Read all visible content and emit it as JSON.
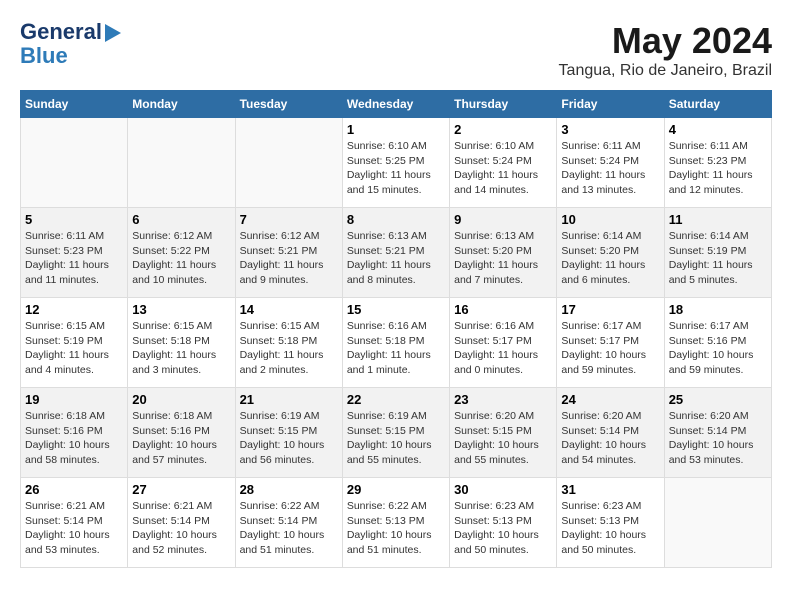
{
  "header": {
    "logo_line1": "General",
    "logo_line2": "Blue",
    "month_title": "May 2024",
    "location": "Tangua, Rio de Janeiro, Brazil"
  },
  "days_of_week": [
    "Sunday",
    "Monday",
    "Tuesday",
    "Wednesday",
    "Thursday",
    "Friday",
    "Saturday"
  ],
  "weeks": [
    [
      {
        "day": "",
        "info": ""
      },
      {
        "day": "",
        "info": ""
      },
      {
        "day": "",
        "info": ""
      },
      {
        "day": "1",
        "info": "Sunrise: 6:10 AM\nSunset: 5:25 PM\nDaylight: 11 hours\nand 15 minutes."
      },
      {
        "day": "2",
        "info": "Sunrise: 6:10 AM\nSunset: 5:24 PM\nDaylight: 11 hours\nand 14 minutes."
      },
      {
        "day": "3",
        "info": "Sunrise: 6:11 AM\nSunset: 5:24 PM\nDaylight: 11 hours\nand 13 minutes."
      },
      {
        "day": "4",
        "info": "Sunrise: 6:11 AM\nSunset: 5:23 PM\nDaylight: 11 hours\nand 12 minutes."
      }
    ],
    [
      {
        "day": "5",
        "info": "Sunrise: 6:11 AM\nSunset: 5:23 PM\nDaylight: 11 hours\nand 11 minutes."
      },
      {
        "day": "6",
        "info": "Sunrise: 6:12 AM\nSunset: 5:22 PM\nDaylight: 11 hours\nand 10 minutes."
      },
      {
        "day": "7",
        "info": "Sunrise: 6:12 AM\nSunset: 5:21 PM\nDaylight: 11 hours\nand 9 minutes."
      },
      {
        "day": "8",
        "info": "Sunrise: 6:13 AM\nSunset: 5:21 PM\nDaylight: 11 hours\nand 8 minutes."
      },
      {
        "day": "9",
        "info": "Sunrise: 6:13 AM\nSunset: 5:20 PM\nDaylight: 11 hours\nand 7 minutes."
      },
      {
        "day": "10",
        "info": "Sunrise: 6:14 AM\nSunset: 5:20 PM\nDaylight: 11 hours\nand 6 minutes."
      },
      {
        "day": "11",
        "info": "Sunrise: 6:14 AM\nSunset: 5:19 PM\nDaylight: 11 hours\nand 5 minutes."
      }
    ],
    [
      {
        "day": "12",
        "info": "Sunrise: 6:15 AM\nSunset: 5:19 PM\nDaylight: 11 hours\nand 4 minutes."
      },
      {
        "day": "13",
        "info": "Sunrise: 6:15 AM\nSunset: 5:18 PM\nDaylight: 11 hours\nand 3 minutes."
      },
      {
        "day": "14",
        "info": "Sunrise: 6:15 AM\nSunset: 5:18 PM\nDaylight: 11 hours\nand 2 minutes."
      },
      {
        "day": "15",
        "info": "Sunrise: 6:16 AM\nSunset: 5:18 PM\nDaylight: 11 hours\nand 1 minute."
      },
      {
        "day": "16",
        "info": "Sunrise: 6:16 AM\nSunset: 5:17 PM\nDaylight: 11 hours\nand 0 minutes."
      },
      {
        "day": "17",
        "info": "Sunrise: 6:17 AM\nSunset: 5:17 PM\nDaylight: 10 hours\nand 59 minutes."
      },
      {
        "day": "18",
        "info": "Sunrise: 6:17 AM\nSunset: 5:16 PM\nDaylight: 10 hours\nand 59 minutes."
      }
    ],
    [
      {
        "day": "19",
        "info": "Sunrise: 6:18 AM\nSunset: 5:16 PM\nDaylight: 10 hours\nand 58 minutes."
      },
      {
        "day": "20",
        "info": "Sunrise: 6:18 AM\nSunset: 5:16 PM\nDaylight: 10 hours\nand 57 minutes."
      },
      {
        "day": "21",
        "info": "Sunrise: 6:19 AM\nSunset: 5:15 PM\nDaylight: 10 hours\nand 56 minutes."
      },
      {
        "day": "22",
        "info": "Sunrise: 6:19 AM\nSunset: 5:15 PM\nDaylight: 10 hours\nand 55 minutes."
      },
      {
        "day": "23",
        "info": "Sunrise: 6:20 AM\nSunset: 5:15 PM\nDaylight: 10 hours\nand 55 minutes."
      },
      {
        "day": "24",
        "info": "Sunrise: 6:20 AM\nSunset: 5:14 PM\nDaylight: 10 hours\nand 54 minutes."
      },
      {
        "day": "25",
        "info": "Sunrise: 6:20 AM\nSunset: 5:14 PM\nDaylight: 10 hours\nand 53 minutes."
      }
    ],
    [
      {
        "day": "26",
        "info": "Sunrise: 6:21 AM\nSunset: 5:14 PM\nDaylight: 10 hours\nand 53 minutes."
      },
      {
        "day": "27",
        "info": "Sunrise: 6:21 AM\nSunset: 5:14 PM\nDaylight: 10 hours\nand 52 minutes."
      },
      {
        "day": "28",
        "info": "Sunrise: 6:22 AM\nSunset: 5:14 PM\nDaylight: 10 hours\nand 51 minutes."
      },
      {
        "day": "29",
        "info": "Sunrise: 6:22 AM\nSunset: 5:13 PM\nDaylight: 10 hours\nand 51 minutes."
      },
      {
        "day": "30",
        "info": "Sunrise: 6:23 AM\nSunset: 5:13 PM\nDaylight: 10 hours\nand 50 minutes."
      },
      {
        "day": "31",
        "info": "Sunrise: 6:23 AM\nSunset: 5:13 PM\nDaylight: 10 hours\nand 50 minutes."
      },
      {
        "day": "",
        "info": ""
      }
    ]
  ]
}
